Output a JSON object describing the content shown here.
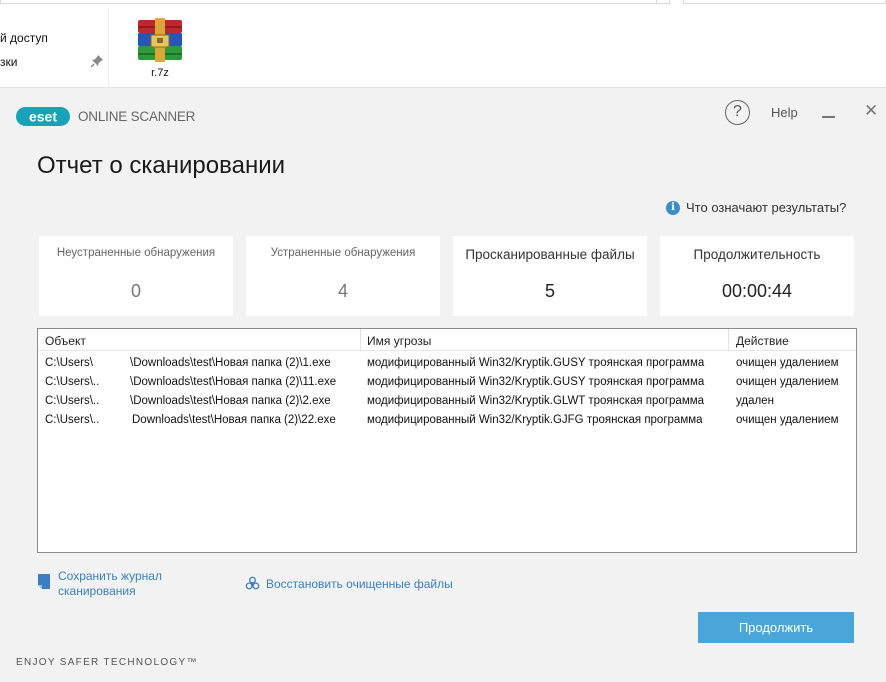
{
  "explorer": {
    "nav_items": [
      "й доступ",
      "зки"
    ],
    "file": {
      "name": "r.7z",
      "icon": "winrar-archive-icon"
    }
  },
  "app": {
    "product": "ONLINE SCANNER",
    "help": "Help",
    "title": "Отчет о сканировании",
    "info_link": "Что означают результаты?",
    "stats": [
      {
        "label": "Неустраненные обнаружения",
        "value": "0"
      },
      {
        "label": "Устраненные обнаружения",
        "value": "4"
      },
      {
        "label": "Просканированные файлы",
        "value": "5"
      },
      {
        "label": "Продолжительность",
        "value": "00:00:44"
      }
    ],
    "table": {
      "columns": [
        "Объект",
        "Имя угрозы",
        "Действие"
      ],
      "rows": [
        {
          "path_start": "C:\\Users\\",
          "path_end": "\\Downloads\\test\\Новая папка (2)\\1.exe",
          "threat": "модифицированный Win32/Kryptik.GUSY троянская программа",
          "action": "очищен удалением"
        },
        {
          "path_start": "C:\\Users\\..",
          "path_end": "\\Downloads\\test\\Новая папка (2)\\11.exe",
          "threat": "модифицированный Win32/Kryptik.GUSY троянская программа",
          "action": "очищен удалением"
        },
        {
          "path_start": "C:\\Users\\..",
          "path_end": "\\Downloads\\test\\Новая папка (2)\\2.exe",
          "threat": "модифицированный Win32/Kryptik.GLWT троянская программа",
          "action": "удален"
        },
        {
          "path_start": "C:\\Users\\..",
          "path_end": "Downloads\\test\\Новая папка (2)\\22.exe",
          "threat": "модифицированный Win32/Kryptik.GJFG троянская программа",
          "action": "очищен удалением"
        }
      ]
    },
    "save_log": [
      "Сохранить журнал",
      "сканирования"
    ],
    "restore": "Восстановить очищенные файлы",
    "continue": "Продолжить",
    "tagline": "ENJOY SAFER TECHNOLOGY™"
  },
  "colors": {
    "accent": "#4aa6d9",
    "link": "#3a7fc1",
    "brand": "#17a2b8"
  }
}
